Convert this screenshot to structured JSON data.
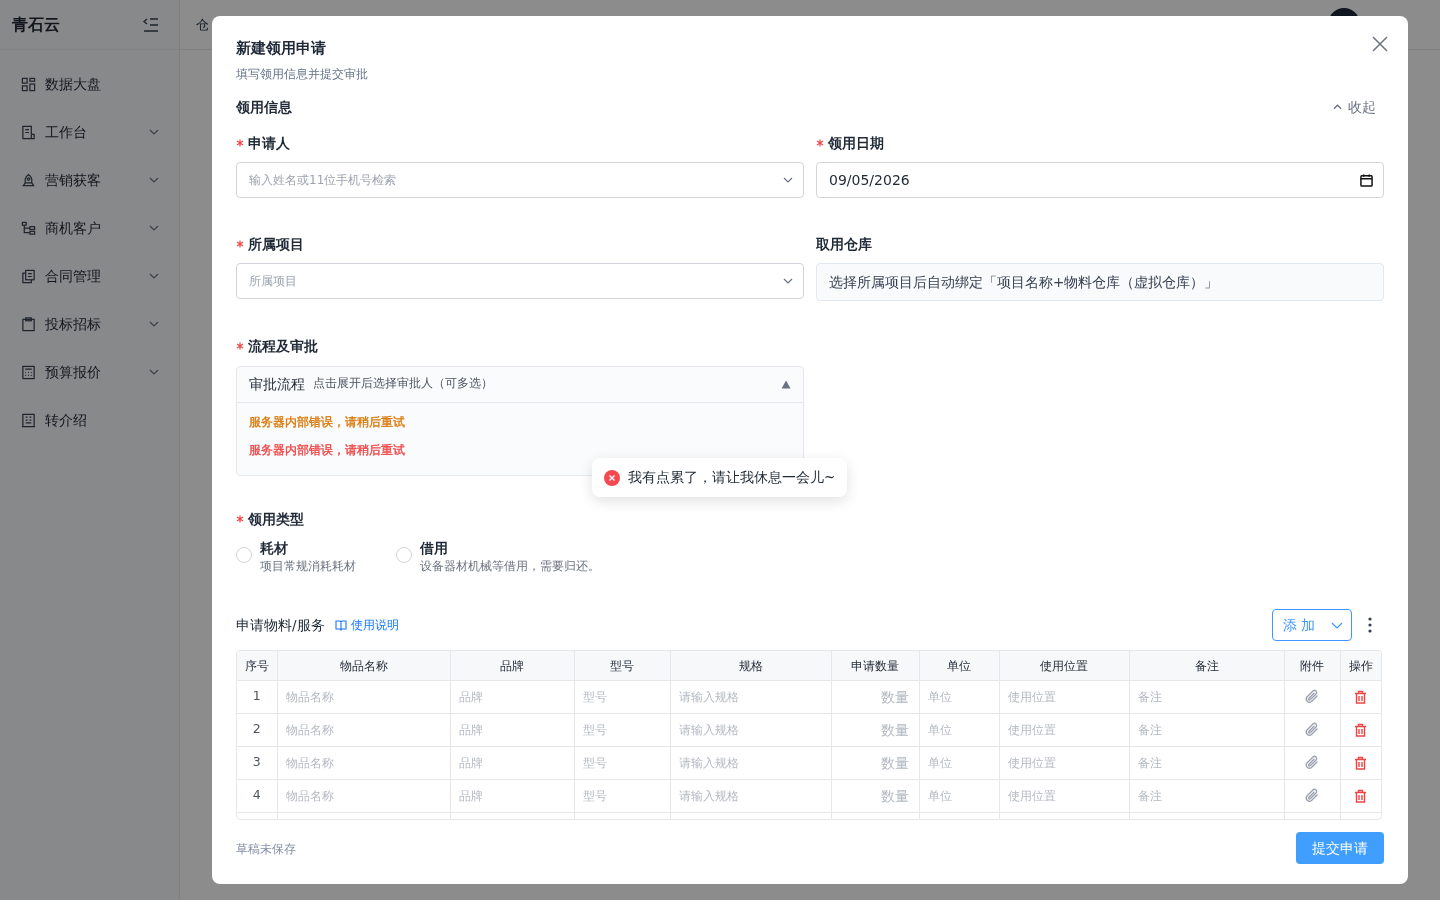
{
  "sidebar": {
    "logo": "青石云",
    "items": [
      {
        "label": "数据大盘",
        "expandable": false
      },
      {
        "label": "工作台",
        "expandable": true
      },
      {
        "label": "营销获客",
        "expandable": true
      },
      {
        "label": "商机客户",
        "expandable": true
      },
      {
        "label": "合同管理",
        "expandable": true
      },
      {
        "label": "投标招标",
        "expandable": true
      },
      {
        "label": "预算报价",
        "expandable": true
      },
      {
        "label": "转介绍",
        "expandable": false
      }
    ]
  },
  "background": {
    "breadcrumb": "仓"
  },
  "modal": {
    "title": "新建领用申请",
    "subtitle": "填写领用信息并提交审批",
    "section_title": "领用信息",
    "collapse_label": "收起",
    "fields": [
      {
        "label": "申请人",
        "required": true,
        "kind": "select",
        "placeholder": "输入姓名或11位手机号检索"
      },
      {
        "label": "领用日期",
        "required": true,
        "kind": "date",
        "value": "09/05/2026"
      },
      {
        "label": "所属项目",
        "required": true,
        "kind": "select",
        "placeholder": "所属项目"
      },
      {
        "label": "取用仓库",
        "required": false,
        "kind": "readonly",
        "value": "选择所属项目后自动绑定「项目名称+物料仓库（虚拟仓库）」"
      }
    ],
    "approval": {
      "label": "流程及审批",
      "required": true,
      "title": "审批流程",
      "hint": "点击展开后选择审批人（可多选）",
      "expanded": true,
      "messages": [
        {
          "text": "服务器内部错误，请稍后重试",
          "color": "#d97706"
        },
        {
          "text": "服务器内部错误，请稍后重试",
          "color": "#ef4444"
        }
      ]
    },
    "usage_type": {
      "label": "领用类型",
      "required": true,
      "options": [
        {
          "title": "耗材",
          "desc": "项目常规消耗耗材",
          "selected": false
        },
        {
          "title": "借用",
          "desc": "设备器材机械等借用，需要归还。",
          "selected": false
        }
      ]
    },
    "materials": {
      "title": "申请物料/服务",
      "help_link": "使用说明",
      "add_button": "添 加",
      "columns": [
        "序号",
        "物品名称",
        "品牌",
        "型号",
        "规格",
        "申请数量",
        "单位",
        "使用位置",
        "备注",
        "附件",
        "操作"
      ],
      "rows": [
        {
          "cells": [
            {
              "text": "1",
              "kind": "index"
            },
            {
              "placeholder": "物品名称"
            },
            {
              "placeholder": "品牌"
            },
            {
              "placeholder": "型号"
            },
            {
              "placeholder": "请输入规格"
            },
            {
              "placeholder": "数量",
              "kind": "number"
            },
            {
              "placeholder": "单位"
            },
            {
              "placeholder": "使用位置"
            },
            {
              "placeholder": "备注"
            }
          ]
        },
        {
          "cells": [
            {
              "text": "2",
              "kind": "index"
            },
            {
              "placeholder": "物品名称"
            },
            {
              "placeholder": "品牌"
            },
            {
              "placeholder": "型号"
            },
            {
              "placeholder": "请输入规格"
            },
            {
              "placeholder": "数量",
              "kind": "number"
            },
            {
              "placeholder": "单位"
            },
            {
              "placeholder": "使用位置"
            },
            {
              "placeholder": "备注"
            }
          ]
        },
        {
          "cells": [
            {
              "text": "3",
              "kind": "index"
            },
            {
              "placeholder": "物品名称"
            },
            {
              "placeholder": "品牌"
            },
            {
              "placeholder": "型号"
            },
            {
              "placeholder": "请输入规格"
            },
            {
              "placeholder": "数量",
              "kind": "number"
            },
            {
              "placeholder": "单位"
            },
            {
              "placeholder": "使用位置"
            },
            {
              "placeholder": "备注"
            }
          ]
        },
        {
          "cells": [
            {
              "text": "4",
              "kind": "index"
            },
            {
              "placeholder": "物品名称"
            },
            {
              "placeholder": "品牌"
            },
            {
              "placeholder": "型号"
            },
            {
              "placeholder": "请输入规格"
            },
            {
              "placeholder": "数量",
              "kind": "number"
            },
            {
              "placeholder": "单位"
            },
            {
              "placeholder": "使用位置"
            },
            {
              "placeholder": "备注"
            }
          ]
        }
      ]
    },
    "footer": {
      "draft_status": "草稿未保存",
      "submit": "提交申请"
    }
  },
  "toast": {
    "text": "我有点累了，请让我休息一会儿~",
    "kind": "error"
  }
}
